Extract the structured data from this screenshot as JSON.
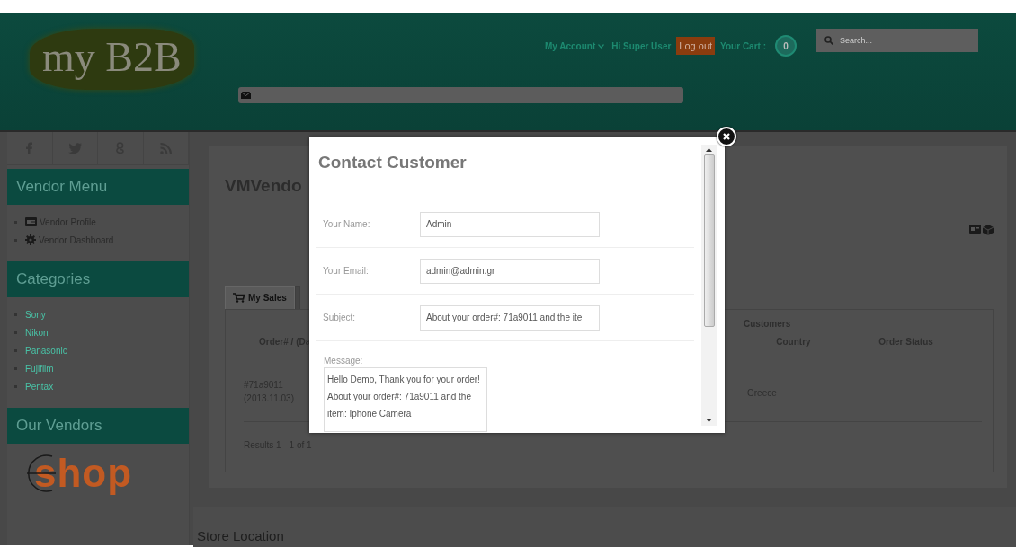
{
  "header": {
    "logo": "my B2B",
    "my_account": "My Account",
    "greeting": "Hi Super User",
    "logout": "Log out",
    "cart_label": "Your Cart :",
    "cart_count": "0",
    "search": {
      "placeholder": "Search..."
    }
  },
  "sidebar": {
    "social": [
      {
        "kind": "facebook"
      },
      {
        "kind": "twitter"
      },
      {
        "kind": "google"
      },
      {
        "kind": "rss"
      }
    ],
    "sections": [
      {
        "title": "Vendor Menu",
        "items": [
          {
            "label": "Vendor Profile",
            "kind": "profile"
          },
          {
            "label": "Vendor Dashboard",
            "kind": "dashboard"
          }
        ]
      },
      {
        "title": "Categories",
        "items": [
          {
            "label": "Sony",
            "kind": "link"
          },
          {
            "label": "Nikon",
            "kind": "link"
          },
          {
            "label": "Panasonic",
            "kind": "link"
          },
          {
            "label": "Fujifilm",
            "kind": "link"
          },
          {
            "label": "Pentax",
            "kind": "link"
          }
        ]
      },
      {
        "title": "Our Vendors"
      }
    ],
    "vendor_logo": "shop"
  },
  "main": {
    "title": "VMVendo",
    "tabs": [
      {
        "label": "My Sales",
        "selected": true
      }
    ],
    "table": {
      "group_heading": "Customers",
      "columns": [
        "Order# / (Da",
        "Country",
        "Order Status"
      ],
      "row": {
        "order": "#71a9011",
        "date": "(2013.11.03)",
        "country": "Greece"
      },
      "results": "Results 1 - 1 of 1"
    }
  },
  "footer_section": "Store Location",
  "modal": {
    "title": "Contact Customer",
    "fields": [
      {
        "label": "Your Name:",
        "value": "Admin"
      },
      {
        "label": "Your Email:",
        "value": "admin@admin.gr"
      },
      {
        "label": "Subject:",
        "value": "About your order#: 71a9011 and the ite"
      }
    ],
    "message_label": "Message:",
    "message": "Hello Demo, Thank you for your order!\nAbout your order#: 71a9011 and the item: Iphone Camera"
  }
}
